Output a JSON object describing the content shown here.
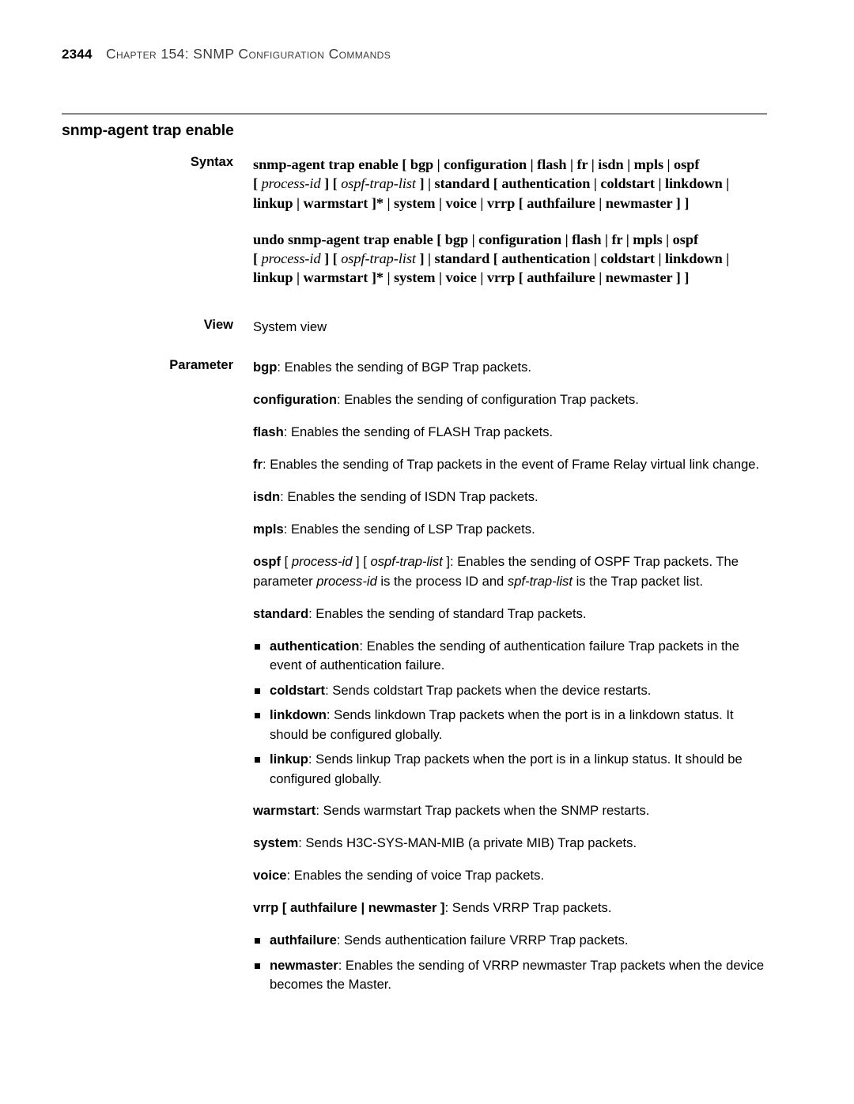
{
  "page": {
    "folio": "2344",
    "running_head": "Chapter 154: SNMP Configuration Commands",
    "command_title": "snmp-agent trap enable"
  },
  "labels": {
    "syntax": "Syntax",
    "view": "View",
    "parameter": "Parameter"
  },
  "syntax": {
    "enable": {
      "line1_cmd": "snmp-agent trap enable",
      "line1_rest": " [ bgp | configuration | flash | fr | isdn | mpls | ospf",
      "line2_a": "[ ",
      "line2_var1": "process-id",
      "line2_b": " ] [ ",
      "line2_var2": "ospf-trap-list",
      "line2_c": " ] | standard [ authentication | coldstart | linkdown |",
      "line3": "linkup | warmstart ]* | system | voice | vrrp [ authfailure | newmaster ] ]"
    },
    "undo": {
      "line1_cmd": "undo snmp-agent trap enable",
      "line1_rest": " [ bgp | configuration | flash | fr | mpls | ospf",
      "line2_a": "[ ",
      "line2_var1": "process-id",
      "line2_b": " ] [ ",
      "line2_var2": "ospf-trap-list",
      "line2_c": " ] | standard [ authentication | coldstart | linkdown |",
      "line3": "linkup | warmstart ]* | system | voice | vrrp [ authfailure | newmaster ] ]"
    }
  },
  "view": {
    "value": "System view"
  },
  "parameters": {
    "bgp": {
      "term": "bgp",
      "desc": ": Enables the sending of BGP Trap packets."
    },
    "configuration": {
      "term": "configuration",
      "desc": ": Enables the sending of configuration Trap packets."
    },
    "flash": {
      "term": "flash",
      "desc": ": Enables the sending of FLASH Trap packets."
    },
    "fr": {
      "term": "fr",
      "desc": ": Enables the sending of Trap packets in the event of Frame Relay virtual link change."
    },
    "isdn": {
      "term": "isdn",
      "desc": ": Enables the sending of ISDN Trap packets."
    },
    "mpls": {
      "term": "mpls",
      "desc": ": Enables the sending of LSP Trap packets."
    },
    "ospf": {
      "term": "ospf",
      "bracket_open": " [ ",
      "var1": "process-id",
      "bracket_mid": " ] [ ",
      "var2": "ospf-trap-list",
      "bracket_close": " ]",
      "desc_part1": ": Enables the sending of OSPF Trap packets. The parameter ",
      "var3": "process-id",
      "desc_part2": " is the process ID and ",
      "var4": "spf-trap-list",
      "desc_part3": " is the Trap packet list."
    },
    "standard": {
      "term": "standard",
      "desc": ": Enables the sending of standard Trap packets."
    },
    "authentication": {
      "term": "authentication",
      "desc": ": Enables the sending of authentication failure Trap packets in the event of authentication failure."
    },
    "coldstart": {
      "term": "coldstart",
      "desc": ": Sends coldstart Trap packets when the device restarts."
    },
    "linkdown": {
      "term": "linkdown",
      "desc": ": Sends linkdown Trap packets when the port is in a linkdown status. It should be configured globally."
    },
    "linkup": {
      "term": "linkup",
      "desc": ": Sends linkup Trap packets when the port is in a linkup status. It should be configured globally."
    },
    "warmstart": {
      "term": "warmstart",
      "desc": ": Sends warmstart Trap packets when the SNMP restarts."
    },
    "system": {
      "term": "system",
      "desc": ": Sends H3C-SYS-MAN-MIB (a private MIB) Trap packets."
    },
    "voice": {
      "term": "voice",
      "desc": ": Enables the sending of voice Trap packets."
    },
    "vrrp": {
      "term": "vrrp",
      "options": " [ authfailure | newmaster ]",
      "desc": ": Sends VRRP Trap packets."
    },
    "authfailure": {
      "term": "authfailure",
      "desc": ": Sends authentication failure VRRP Trap packets."
    },
    "newmaster": {
      "term": "newmaster",
      "desc": ": Enables the sending of VRRP newmaster Trap packets when the device becomes the Master."
    }
  }
}
